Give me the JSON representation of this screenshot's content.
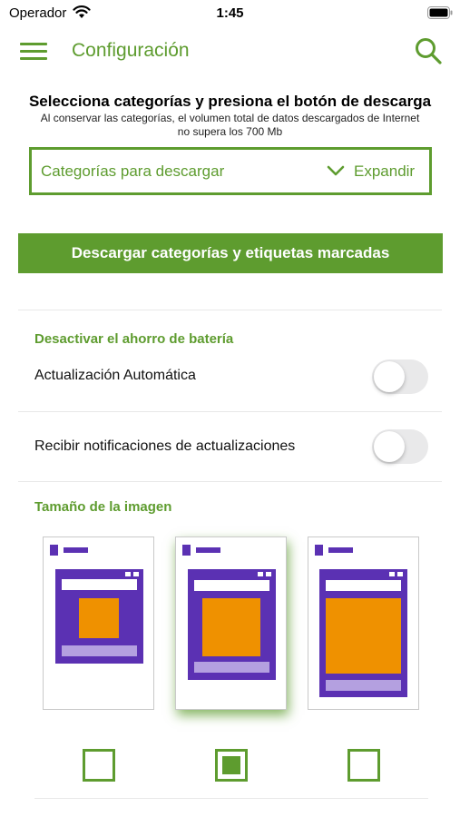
{
  "status_bar": {
    "carrier": "Operador",
    "time": "1:45"
  },
  "app_bar": {
    "title": "Configuración",
    "menu_icon": "hamburger-menu-icon",
    "search_icon": "search-icon"
  },
  "intro": {
    "title": "Selecciona categorías y presiona el botón de descarga",
    "subtitle_line1": "Al conservar las categorías, el volumen total de datos descargados de Internet",
    "subtitle_line2": "no supera los  700 Mb"
  },
  "categories": {
    "label": "Categorías para descargar",
    "action": "Expandir",
    "chevron_icon": "chevron-down-icon"
  },
  "download_button": "Descargar categorías y etiquetas marcadas",
  "battery_section": {
    "title": "Desactivar el ahorro de batería",
    "auto_update": {
      "label": "Actualización Automática",
      "on": false
    },
    "notifications": {
      "label": "Recibir notificaciones de actualizaciones",
      "on": false
    }
  },
  "image_size_section": {
    "title": "Tamaño de la imagen",
    "options": [
      {
        "name": "small",
        "selected": false
      },
      {
        "name": "medium",
        "selected": true
      },
      {
        "name": "large",
        "selected": false
      }
    ]
  },
  "colors": {
    "accent": "#5e9c2f",
    "purple": "#5b31b3",
    "orange": "#ef9100",
    "lavender": "#b4a0e0",
    "toggle_off": "#e9e9ea"
  }
}
